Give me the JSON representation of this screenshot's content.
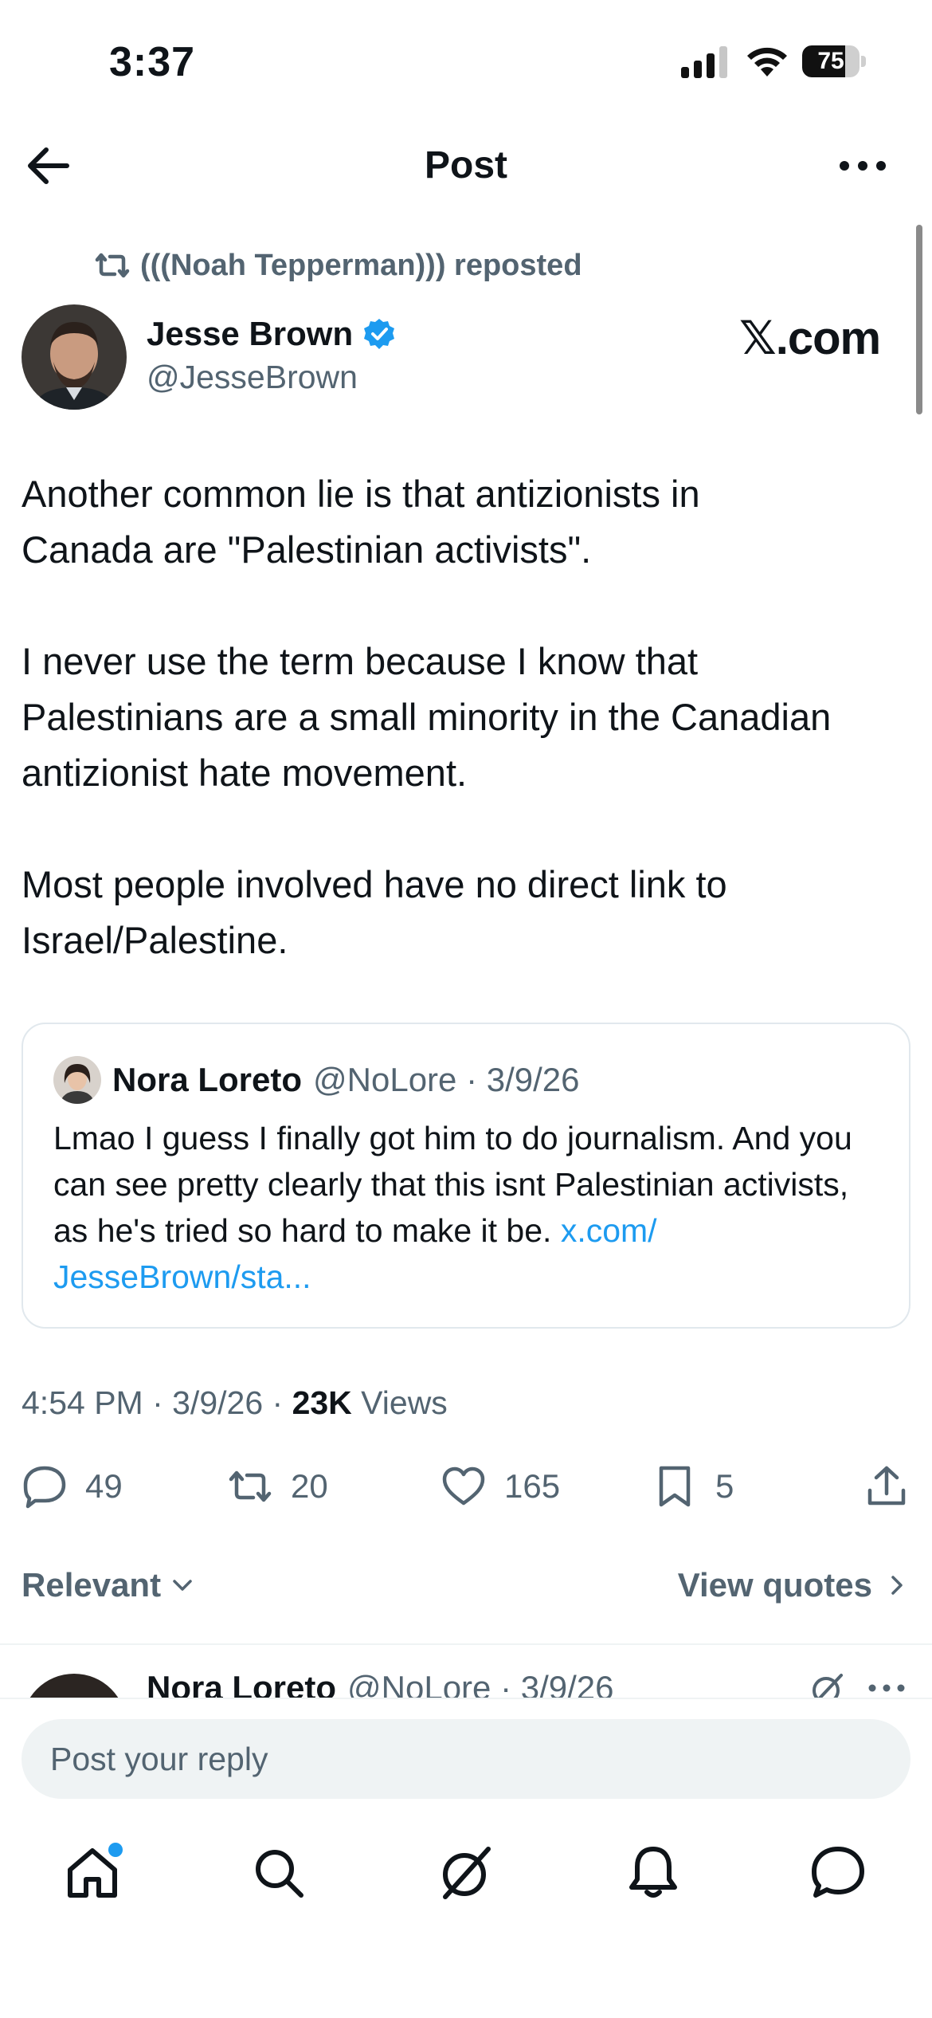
{
  "status": {
    "time": "3:37",
    "battery": "75",
    "battery_level": 0.75
  },
  "nav": {
    "title": "Post"
  },
  "post": {
    "repost_label": "(((Noah Tepperman))) reposted",
    "author_name": "Jesse Brown",
    "author_handle": "@JesseBrown",
    "watermark": "𝕏.com",
    "body": "Another common lie is that antizionists in\nCanada are \"Palestinian activists\".\n\nI never use the term because I know that\nPalestinians are a small minority in the Canadian\nantizionist hate movement.\n\nMost people involved have no direct link to\nIsrael/Palestine.",
    "quote": {
      "name": "Nora Loreto",
      "meta": "@NoLore · 3/9/26",
      "text": "Lmao I guess I finally got him to do journalism. And you can see pretty clearly that this isnt Palestinian activists, as he's tried so hard to make it be. ",
      "link": "x.com/ JesseBrown/sta..."
    },
    "timestamp": "4:54 PM · 3/9/26 · ",
    "views_count": "23K",
    "views_label": " Views",
    "actions": {
      "replies": "49",
      "reposts": "20",
      "likes": "165",
      "bookmarks": "5"
    }
  },
  "sort": {
    "relevant": "Relevant",
    "view_quotes": "View quotes"
  },
  "reply_preview": {
    "name": "Nora Loreto",
    "meta": "@NoLore · 3/9/26"
  },
  "reply_bar": {
    "placeholder": "Post your reply"
  },
  "colors": {
    "accent": "#1d9bf0",
    "secondary_text": "#536471",
    "text": "#0f1419"
  },
  "icons": {
    "tabs": [
      "home-icon",
      "search-icon",
      "grok-icon",
      "notifications-icon",
      "messages-icon"
    ]
  }
}
